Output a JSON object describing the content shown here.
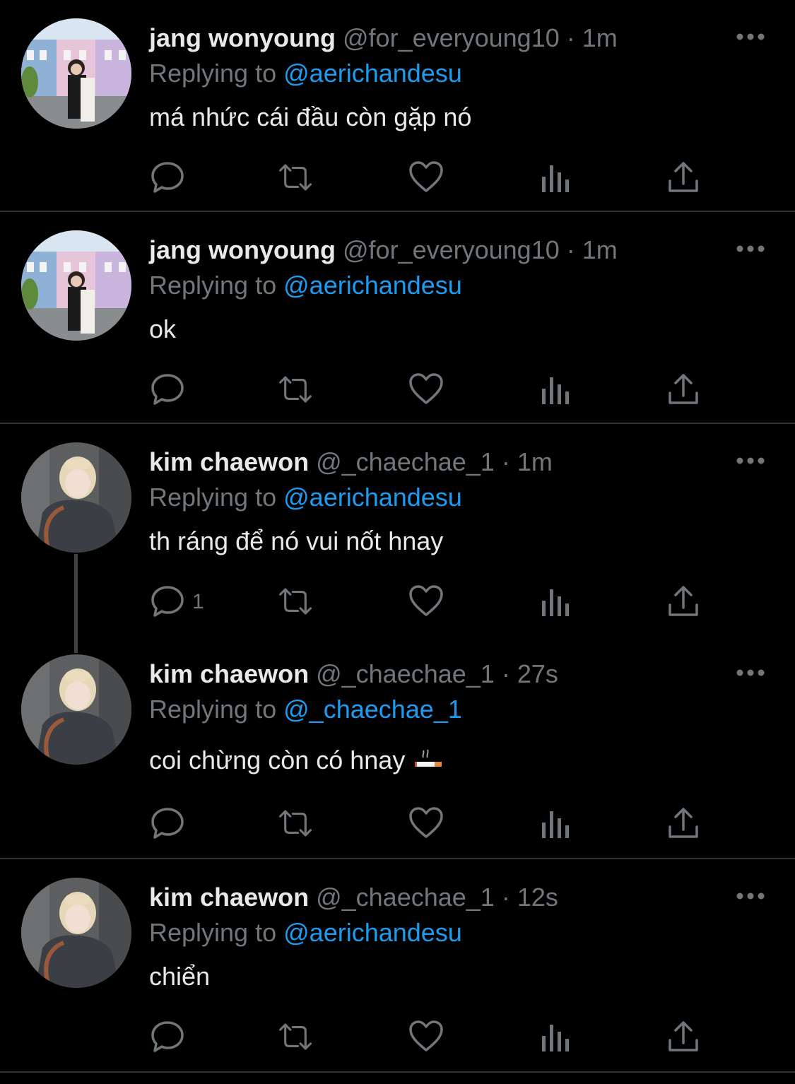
{
  "colors": {
    "background": "#000000",
    "mention": "#1d9bf0",
    "secondary": "#71767b",
    "divider": "#2f3336"
  },
  "icons": [
    "more-icon",
    "reply-icon",
    "retweet-icon",
    "like-icon",
    "views-icon",
    "share-icon",
    "cigarette-emoji"
  ],
  "tweets": [
    {
      "name": "jang wonyoung",
      "handle": "@for_everyoung10",
      "dot": "·",
      "time": "1m",
      "replying_prefix": "Replying to",
      "replying_to": "@aerichandesu",
      "text": "má nhức cái đầu còn gặp nó",
      "reply_count": ""
    },
    {
      "name": "jang wonyoung",
      "handle": "@for_everyoung10",
      "dot": "·",
      "time": "1m",
      "replying_prefix": "Replying to",
      "replying_to": "@aerichandesu",
      "text": "ok",
      "reply_count": ""
    },
    {
      "name": "kim chaewon",
      "handle": "@_chaechae_1",
      "dot": "·",
      "time": "1m",
      "replying_prefix": "Replying to",
      "replying_to": "@aerichandesu",
      "text": "th ráng để nó vui nốt hnay",
      "reply_count": "1"
    },
    {
      "name": "kim chaewon",
      "handle": "@_chaechae_1",
      "dot": "·",
      "time": "27s",
      "replying_prefix": "Replying to",
      "replying_to": "@_chaechae_1",
      "text": "coi chừng còn có hnay",
      "reply_count": ""
    },
    {
      "name": "kim chaewon",
      "handle": "@_chaechae_1",
      "dot": "·",
      "time": "12s",
      "replying_prefix": "Replying to",
      "replying_to": "@aerichandesu",
      "text": "chiển",
      "reply_count": ""
    }
  ]
}
